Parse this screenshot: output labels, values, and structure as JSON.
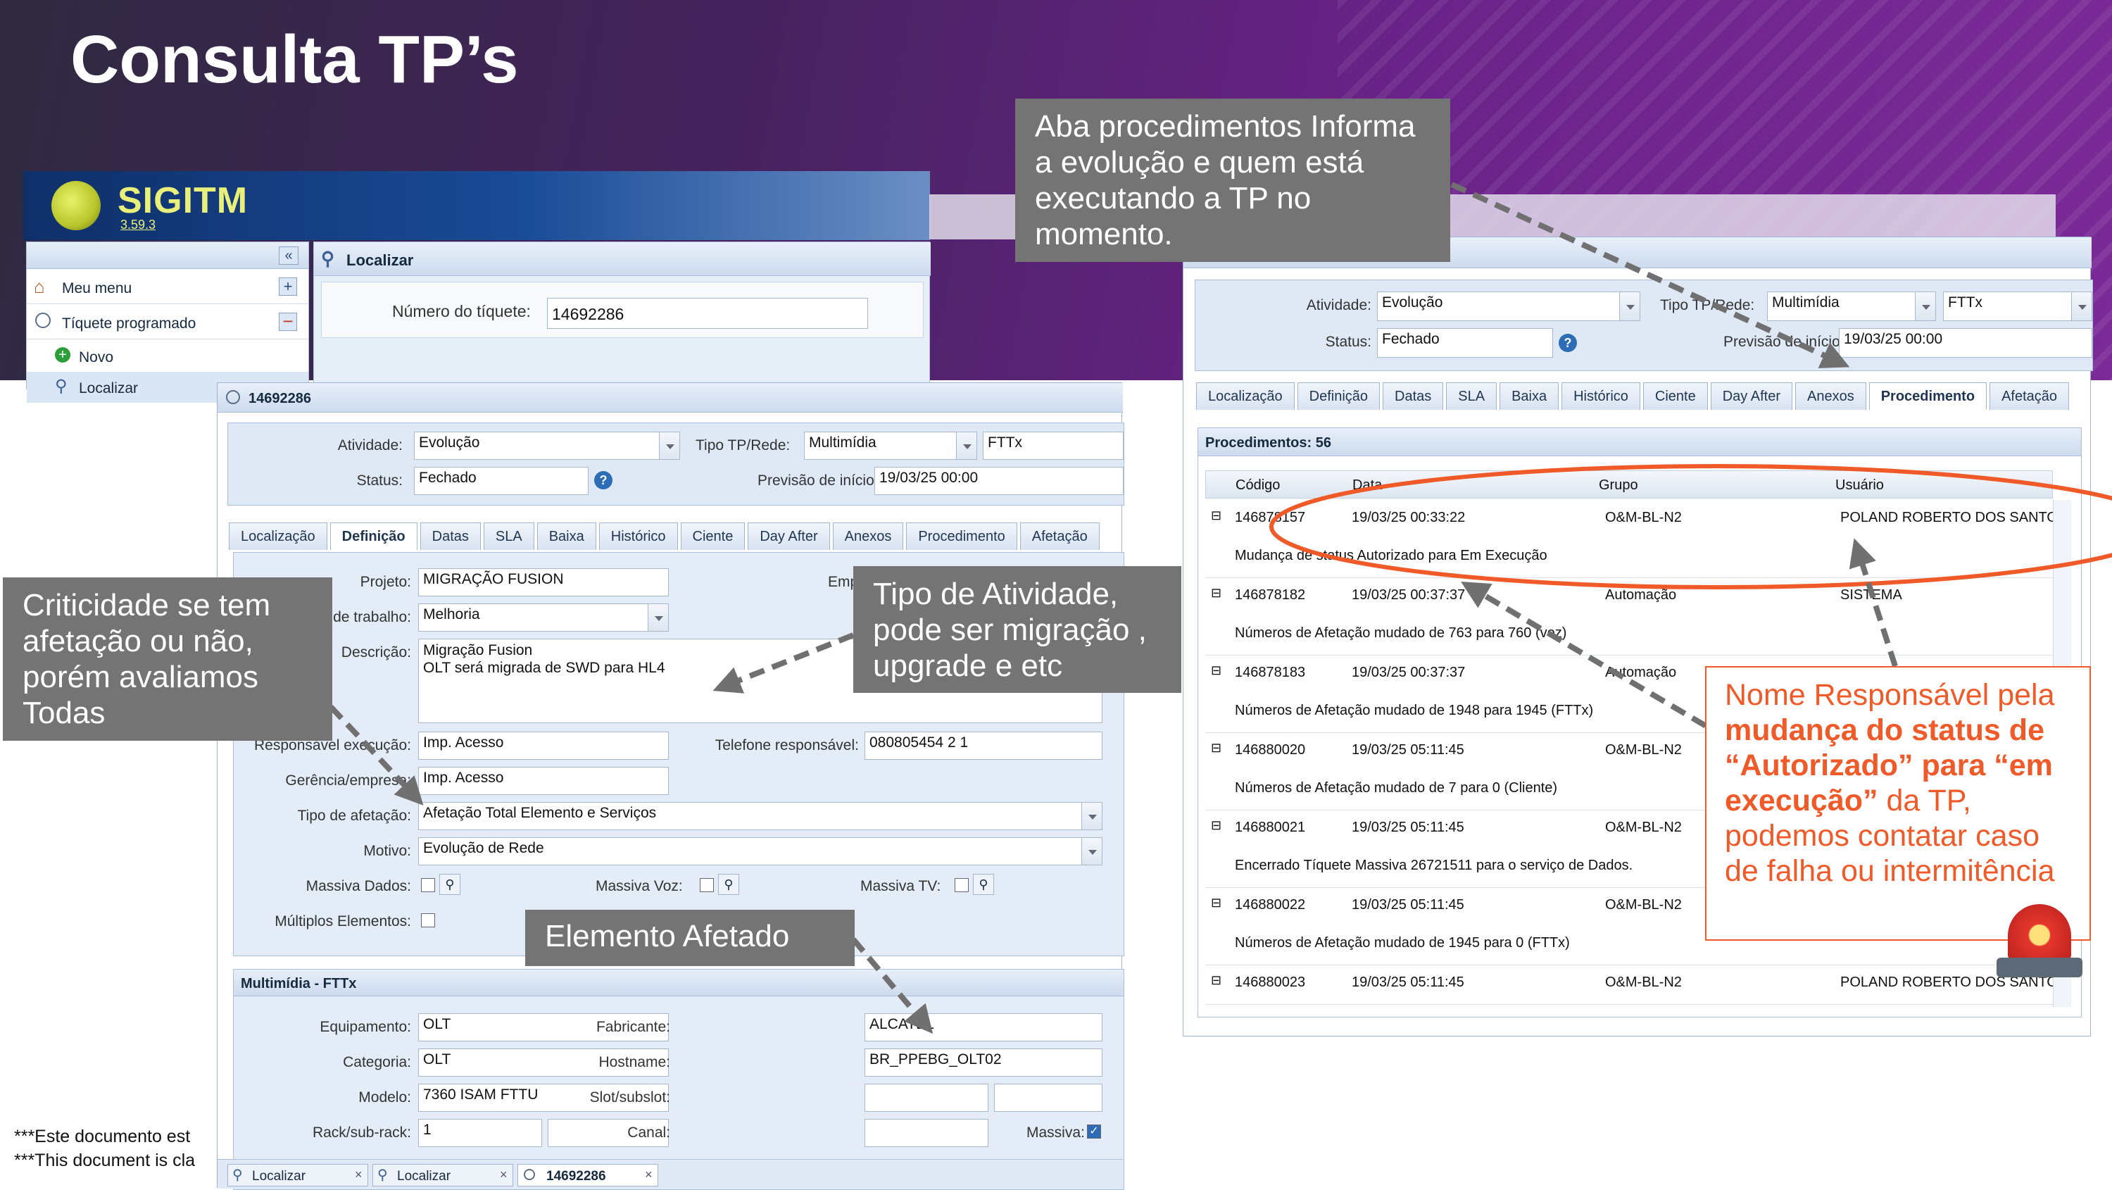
{
  "slide": {
    "title": "Consulta TP’s",
    "footer_lines": [
      "***Este documento est",
      "***This document is cla"
    ]
  },
  "colors": {
    "header_bg": "#4a2467",
    "callout_bg": "#747474",
    "highlight": "#f05a28"
  },
  "app": {
    "logo_text": "SIGITM",
    "version": "3.59.3",
    "sidebar": {
      "collapse_icon": "double-chevron-left-icon",
      "items": [
        {
          "label": "Meu menu",
          "icon": "home-icon"
        },
        {
          "label": "Tíquete programado",
          "icon": "clock-icon"
        },
        {
          "label": "Novo",
          "icon": "plus-circle-icon"
        },
        {
          "label": "Localizar",
          "icon": "search-icon"
        }
      ]
    },
    "localizar": {
      "title": "Localizar",
      "ticket_label": "Número do tíquete:",
      "ticket_value": "14692286"
    }
  },
  "ticket": {
    "title": "14692286",
    "atividade_label": "Atividade:",
    "atividade": "Evolução",
    "tipo_label": "Tipo TP/Rede:",
    "tipo": "Multimídia",
    "tipo2": "FTTx",
    "status_label": "Status:",
    "status": "Fechado",
    "previsao_label": "Previsão de início:",
    "previsao": "19/03/25 00:00",
    "tabs": [
      "Localização",
      "Definição",
      "Datas",
      "SLA",
      "Baixa",
      "Histórico",
      "Ciente",
      "Day After",
      "Anexos",
      "Procedimento",
      "Afetação"
    ],
    "active_tab": "Definição",
    "definicao": {
      "projeto_label": "Projeto:",
      "projeto": "MIGRAÇÃO FUSION",
      "empresa_label": "Empresa:",
      "trabalho_label": "o de trabalho:",
      "trabalho": "Melhoria",
      "descricao_label": "Descrição:",
      "descricao_line1": "Migração Fusion",
      "descricao_line2": "OLT será migrada de SWD para HL4",
      "resp_label": "Responsável execução:",
      "resp": "Imp. Acesso",
      "tel_label": "Telefone responsável:",
      "tel": "080805454 2 1",
      "gerencia_label": "Gerência/empresa:",
      "gerencia": "Imp. Acesso",
      "afetacao_label": "Tipo de afetação:",
      "afetacao": "Afetação Total Elemento e Serviços",
      "motivo_label": "Motivo:",
      "motivo": "Evolução de Rede",
      "massiva_dados": "Massiva Dados:",
      "massiva_voz": "Massiva Voz:",
      "massiva_tv": "Massiva TV:",
      "multiplos": "Múltiplos Elementos:"
    },
    "multimidia": {
      "title": "Multimídia - FTTx",
      "equip_label": "Equipamento:",
      "equip": "OLT",
      "fab_label": "Fabricante:",
      "fab": "ALCATEL",
      "cat_label": "Categoria:",
      "cat": "OLT",
      "host_label": "Hostname:",
      "host": "BR_PPEBG_OLT02",
      "modelo_label": "Modelo:",
      "modelo": "7360 ISAM FTTU",
      "slot_label": "Slot/subslot:",
      "rack_label": "Rack/sub-rack:",
      "rack": "1",
      "canal_label": "Canal:",
      "massiva_label": "Massiva:"
    },
    "bottom_tabs": [
      "Localizar",
      "Localizar",
      "14692286"
    ]
  },
  "right": {
    "atividade_label": "Atividade:",
    "atividade": "Evolução",
    "tipo_label": "Tipo TP/Rede:",
    "tipo": "Multimídia",
    "tipo2": "FTTx",
    "status_label": "Status:",
    "status": "Fechado",
    "previsao_label": "Previsão de início:",
    "previsao": "19/03/25 00:00",
    "tabs": [
      "Localização",
      "Definição",
      "Datas",
      "SLA",
      "Baixa",
      "Histórico",
      "Ciente",
      "Day After",
      "Anexos",
      "Procedimento",
      "Afetação"
    ],
    "active_tab": "Procedimento",
    "proc_title": "Procedimentos: 56",
    "columns": [
      "Código",
      "Data",
      "Grupo",
      "Usuário"
    ],
    "rows": [
      {
        "codigo": "146878157",
        "data": "19/03/25 00:33:22",
        "grupo": "O&M-BL-N2",
        "usuario": "POLAND ROBERTO DOS SANTOS",
        "desc": "Mudança de status Autorizado para Em Execução"
      },
      {
        "codigo": "146878182",
        "data": "19/03/25 00:37:37",
        "grupo": "Automação",
        "usuario": "SISTEMA",
        "desc": "Números de Afetação mudado de 763 para 760 (voz)"
      },
      {
        "codigo": "146878183",
        "data": "19/03/25 00:37:37",
        "grupo": "Automação",
        "usuario": "",
        "desc": "Números de Afetação mudado de 1948 para 1945 (FTTx)"
      },
      {
        "codigo": "146880020",
        "data": "19/03/25 05:11:45",
        "grupo": "O&M-BL-N2",
        "usuario": "",
        "desc": "Números de Afetação mudado de 7 para 0 (Cliente)"
      },
      {
        "codigo": "146880021",
        "data": "19/03/25 05:11:45",
        "grupo": "O&M-BL-N2",
        "usuario": "",
        "desc": "Encerrado Tíquete Massiva 26721511 para o serviço de Dados."
      },
      {
        "codigo": "146880022",
        "data": "19/03/25 05:11:45",
        "grupo": "O&M-BL-N2",
        "usuario": "",
        "desc": "Números de Afetação mudado de 1945 para 0 (FTTx)"
      },
      {
        "codigo": "146880023",
        "data": "19/03/25 05:11:45",
        "grupo": "O&M-BL-N2",
        "usuario": "POLAND ROBERTO DOS SANTOS",
        "desc": ""
      }
    ]
  },
  "callouts": {
    "procedimentos": "Aba procedimentos Informa  a evolução e quem está executando a TP no momento.",
    "criticidade": "Criticidade se tem afetação ou não, porém avaliamos Todas",
    "tipo_atividade": "Tipo de Atividade, pode ser migração , upgrade e etc",
    "elemento": "Elemento Afetado",
    "responsavel_part1": "Nome Responsável pela ",
    "responsavel_bold": "mudança do status de “Autorizado” para “em execução”",
    "responsavel_part2": " da TP, podemos contatar caso de falha ou intermitência"
  }
}
